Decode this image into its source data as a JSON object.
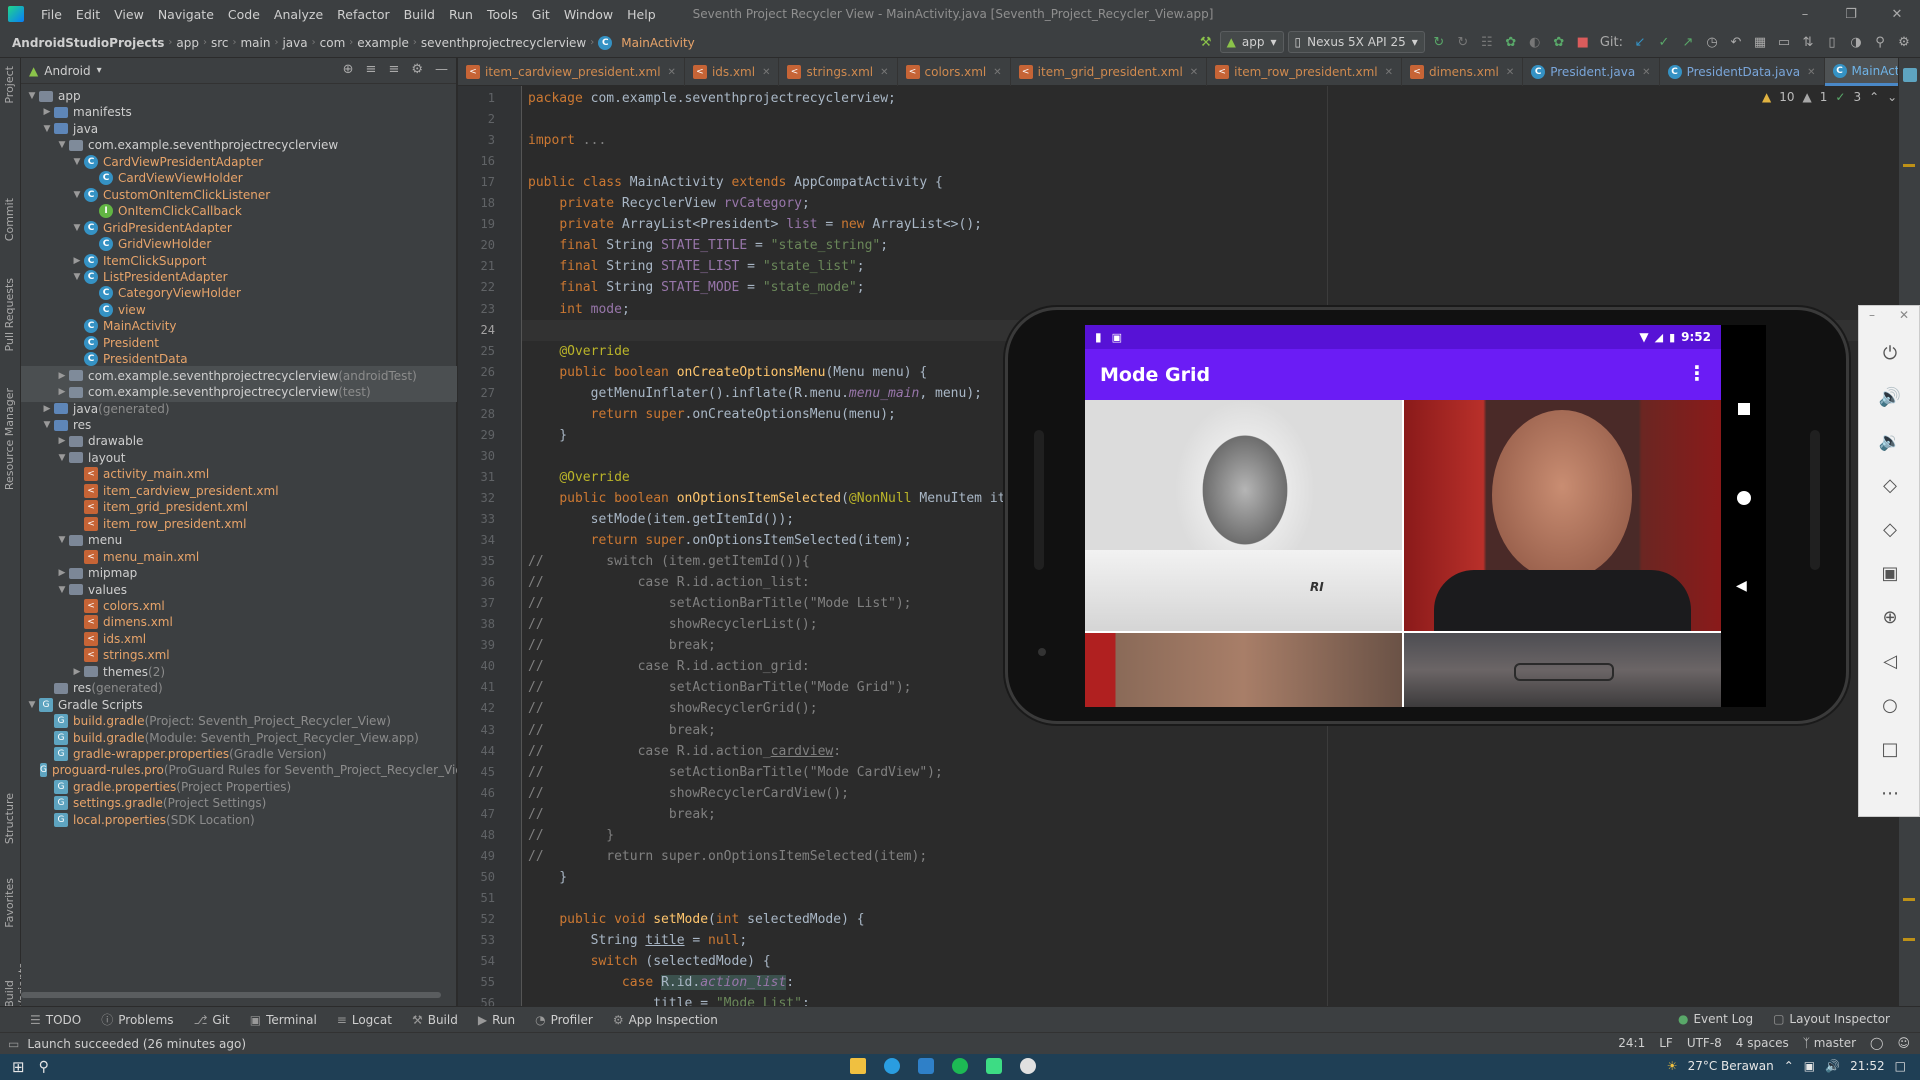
{
  "window": {
    "menus": [
      "File",
      "Edit",
      "View",
      "Navigate",
      "Code",
      "Analyze",
      "Refactor",
      "Build",
      "Run",
      "Tools",
      "Git",
      "Window",
      "Help"
    ],
    "title": "Seventh Project Recycler View - MainActivity.java [Seventh_Project_Recycler_View.app]"
  },
  "breadcrumb": [
    "AndroidStudioProjects",
    "app",
    "src",
    "main",
    "java",
    "com",
    "example",
    "seventhprojectrecyclerview",
    "MainActivity"
  ],
  "toolbar": {
    "run_config": "app",
    "device": "Nexus 5X API 25",
    "git_label": "Git:"
  },
  "left_strip": {
    "tabs": [
      "Project",
      "Commit",
      "Pull Requests",
      "Resource Manager",
      "Structure",
      "Favorites",
      "Build Variants"
    ]
  },
  "project_panel": {
    "view": "Android",
    "tree": [
      {
        "label": "app",
        "depth": 0,
        "icon": "folder",
        "color": "default",
        "arrow": "down"
      },
      {
        "label": "manifests",
        "depth": 1,
        "icon": "folder-blue",
        "color": "default",
        "arrow": "right"
      },
      {
        "label": "java",
        "depth": 1,
        "icon": "folder-blue",
        "color": "default",
        "arrow": "down"
      },
      {
        "label": "com.example.seventhprojectrecyclerview",
        "depth": 2,
        "icon": "pkg",
        "color": "default",
        "arrow": "down"
      },
      {
        "label": "CardViewPresidentAdapter",
        "depth": 3,
        "icon": "cls",
        "color": "orange",
        "arrow": "down"
      },
      {
        "label": "CardViewViewHolder",
        "depth": 4,
        "icon": "cls",
        "color": "orange",
        "arrow": ""
      },
      {
        "label": "CustomOnItemClickListener",
        "depth": 3,
        "icon": "cls",
        "color": "orange",
        "arrow": "down"
      },
      {
        "label": "OnItemClickCallback",
        "depth": 4,
        "icon": "iface",
        "color": "orange",
        "arrow": ""
      },
      {
        "label": "GridPresidentAdapter",
        "depth": 3,
        "icon": "cls",
        "color": "orange",
        "arrow": "down"
      },
      {
        "label": "GridViewHolder",
        "depth": 4,
        "icon": "cls",
        "color": "orange",
        "arrow": ""
      },
      {
        "label": "ItemClickSupport",
        "depth": 3,
        "icon": "cls",
        "color": "orange",
        "arrow": "right"
      },
      {
        "label": "ListPresidentAdapter",
        "depth": 3,
        "icon": "cls",
        "color": "orange",
        "arrow": "down"
      },
      {
        "label": "CategoryViewHolder",
        "depth": 4,
        "icon": "cls",
        "color": "orange",
        "arrow": ""
      },
      {
        "label": "view",
        "depth": 4,
        "icon": "cls",
        "color": "orange",
        "arrow": ""
      },
      {
        "label": "MainActivity",
        "depth": 3,
        "icon": "cls",
        "color": "orange",
        "arrow": ""
      },
      {
        "label": "President",
        "depth": 3,
        "icon": "cls",
        "color": "orange",
        "arrow": ""
      },
      {
        "label": "PresidentData",
        "depth": 3,
        "icon": "cls",
        "color": "orange",
        "arrow": ""
      },
      {
        "label": "com.example.seventhprojectrecyclerview",
        "suffix": " (androidTest)",
        "depth": 2,
        "icon": "pkg",
        "color": "default",
        "arrow": "right",
        "selected": true
      },
      {
        "label": "com.example.seventhprojectrecyclerview",
        "suffix": " (test)",
        "depth": 2,
        "icon": "pkg",
        "color": "default",
        "arrow": "right",
        "selected": true
      },
      {
        "label": "java",
        "suffix": " (generated)",
        "depth": 1,
        "icon": "folder-blue",
        "color": "default",
        "arrow": "right"
      },
      {
        "label": "res",
        "depth": 1,
        "icon": "folder-blue",
        "color": "default",
        "arrow": "down"
      },
      {
        "label": "drawable",
        "depth": 2,
        "icon": "folder",
        "color": "default",
        "arrow": "right"
      },
      {
        "label": "layout",
        "depth": 2,
        "icon": "folder",
        "color": "default",
        "arrow": "down"
      },
      {
        "label": "activity_main.xml",
        "depth": 3,
        "icon": "xml",
        "color": "orange",
        "arrow": ""
      },
      {
        "label": "item_cardview_president.xml",
        "depth": 3,
        "icon": "xml",
        "color": "orange",
        "arrow": ""
      },
      {
        "label": "item_grid_president.xml",
        "depth": 3,
        "icon": "xml",
        "color": "orange",
        "arrow": ""
      },
      {
        "label": "item_row_president.xml",
        "depth": 3,
        "icon": "xml",
        "color": "orange",
        "arrow": ""
      },
      {
        "label": "menu",
        "depth": 2,
        "icon": "folder",
        "color": "default",
        "arrow": "down"
      },
      {
        "label": "menu_main.xml",
        "depth": 3,
        "icon": "xml",
        "color": "orange",
        "arrow": ""
      },
      {
        "label": "mipmap",
        "depth": 2,
        "icon": "folder",
        "color": "default",
        "arrow": "right"
      },
      {
        "label": "values",
        "depth": 2,
        "icon": "folder",
        "color": "default",
        "arrow": "down"
      },
      {
        "label": "colors.xml",
        "depth": 3,
        "icon": "xml",
        "color": "orange",
        "arrow": ""
      },
      {
        "label": "dimens.xml",
        "depth": 3,
        "icon": "xml",
        "color": "orange",
        "arrow": ""
      },
      {
        "label": "ids.xml",
        "depth": 3,
        "icon": "xml",
        "color": "orange",
        "arrow": ""
      },
      {
        "label": "strings.xml",
        "depth": 3,
        "icon": "xml",
        "color": "orange",
        "arrow": ""
      },
      {
        "label": "themes",
        "suffix": " (2)",
        "depth": 3,
        "icon": "folder",
        "color": "default",
        "arrow": "right"
      },
      {
        "label": "res",
        "suffix": " (generated)",
        "depth": 1,
        "icon": "folder",
        "color": "default",
        "arrow": ""
      },
      {
        "label": "Gradle Scripts",
        "depth": 0,
        "icon": "gradle",
        "color": "default",
        "arrow": "down"
      },
      {
        "label": "build.gradle",
        "suffix": " (Project: Seventh_Project_Recycler_View)",
        "depth": 1,
        "icon": "gradle",
        "color": "orange",
        "arrow": ""
      },
      {
        "label": "build.gradle",
        "suffix": " (Module: Seventh_Project_Recycler_View.app)",
        "depth": 1,
        "icon": "gradle",
        "color": "orange",
        "arrow": ""
      },
      {
        "label": "gradle-wrapper.properties",
        "suffix": " (Gradle Version)",
        "depth": 1,
        "icon": "gradle",
        "color": "orange",
        "arrow": ""
      },
      {
        "label": "proguard-rules.pro",
        "suffix": " (ProGuard Rules for Seventh_Project_Recycler_View",
        "depth": 1,
        "icon": "gradle",
        "color": "orange",
        "arrow": ""
      },
      {
        "label": "gradle.properties",
        "suffix": " (Project Properties)",
        "depth": 1,
        "icon": "gradle",
        "color": "orange",
        "arrow": ""
      },
      {
        "label": "settings.gradle",
        "suffix": " (Project Settings)",
        "depth": 1,
        "icon": "gradle",
        "color": "orange",
        "arrow": ""
      },
      {
        "label": "local.properties",
        "suffix": " (SDK Location)",
        "depth": 1,
        "icon": "gradle",
        "color": "orange",
        "arrow": ""
      }
    ]
  },
  "editor_tabs": [
    {
      "label": "item_cardview_president.xml",
      "kind": "xml"
    },
    {
      "label": "ids.xml",
      "kind": "xml"
    },
    {
      "label": "strings.xml",
      "kind": "xml"
    },
    {
      "label": "colors.xml",
      "kind": "xml"
    },
    {
      "label": "item_grid_president.xml",
      "kind": "xml"
    },
    {
      "label": "item_row_president.xml",
      "kind": "xml"
    },
    {
      "label": "dimens.xml",
      "kind": "xml"
    },
    {
      "label": "President.java",
      "kind": "java"
    },
    {
      "label": "PresidentData.java",
      "kind": "java"
    },
    {
      "label": "MainActivity.java",
      "kind": "java",
      "active": true
    }
  ],
  "inspections": {
    "warnings": "10",
    "weak_warnings": "1",
    "ok": "3"
  },
  "code_lines": [
    {
      "n": "1",
      "html": "<span class=\"kw\">package</span> com.example.seventhprojectrecyclerview;"
    },
    {
      "n": "2",
      "html": ""
    },
    {
      "n": "3",
      "html": "<span class=\"kw\">import</span> <span class=\"cmt\">...</span>"
    },
    {
      "n": "16",
      "html": ""
    },
    {
      "n": "17",
      "html": "<span class=\"kw\">public class</span> MainActivity <span class=\"kw\">extends</span> AppCompatActivity {"
    },
    {
      "n": "18",
      "html": "    <span class=\"kw\">private</span> RecyclerView <span class=\"field\">rvCategory</span>;"
    },
    {
      "n": "19",
      "html": "    <span class=\"kw\">private</span> ArrayList&lt;President&gt; <span class=\"field\">list</span> = <span class=\"kw\">new</span> ArrayList&lt;&gt;();"
    },
    {
      "n": "20",
      "html": "    <span class=\"kw\">final</span> String <span class=\"field\">STATE_TITLE</span> = <span class=\"str\">\"state_string\"</span>;"
    },
    {
      "n": "21",
      "html": "    <span class=\"kw\">final</span> String <span class=\"field\">STATE_LIST</span> = <span class=\"str\">\"state_list\"</span>;"
    },
    {
      "n": "22",
      "html": "    <span class=\"kw\">final</span> String <span class=\"field\">STATE_MODE</span> = <span class=\"str\">\"state_mode\"</span>;"
    },
    {
      "n": "23",
      "html": "    <span class=\"kw\">int</span> <span class=\"field\">mode</span>;"
    },
    {
      "n": "24",
      "html": "",
      "current": true
    },
    {
      "n": "25",
      "html": "    <span class=\"ann\">@Override</span>"
    },
    {
      "n": "26",
      "html": "    <span class=\"kw\">public boolean</span> <span class=\"fn\">onCreateOptionsMenu</span>(Menu menu) {"
    },
    {
      "n": "27",
      "html": "        getMenuInflater().inflate(R.menu.<span class=\"fld-i\">menu_main</span>, menu);"
    },
    {
      "n": "28",
      "html": "        <span class=\"kw\">return super</span>.onCreateOptionsMenu(menu);"
    },
    {
      "n": "29",
      "html": "    }"
    },
    {
      "n": "30",
      "html": ""
    },
    {
      "n": "31",
      "html": "    <span class=\"ann\">@Override</span>"
    },
    {
      "n": "32",
      "html": "    <span class=\"kw\">public boolean</span> <span class=\"fn\">onOptionsItemSelected</span>(<span class=\"ann\">@NonNull</span> MenuItem item) {"
    },
    {
      "n": "33",
      "html": "        setMode(item.getItemId());"
    },
    {
      "n": "34",
      "html": "        <span class=\"kw\">return super</span>.onOptionsItemSelected(item);"
    },
    {
      "n": "35",
      "html": "<span class=\"cmt\">//</span>        <span class=\"cmt\">switch (item.getItemId()){</span>"
    },
    {
      "n": "36",
      "html": "<span class=\"cmt\">//            case R.id.action_list:</span>"
    },
    {
      "n": "37",
      "html": "<span class=\"cmt\">//                setActionBarTitle(\"Mode List\");</span>"
    },
    {
      "n": "38",
      "html": "<span class=\"cmt\">//                showRecyclerList();</span>"
    },
    {
      "n": "39",
      "html": "<span class=\"cmt\">//                break;</span>"
    },
    {
      "n": "40",
      "html": "<span class=\"cmt\">//            case R.id.action_grid:</span>"
    },
    {
      "n": "41",
      "html": "<span class=\"cmt\">//                setActionBarTitle(\"Mode Grid\");</span>"
    },
    {
      "n": "42",
      "html": "<span class=\"cmt\">//                showRecyclerGrid();</span>"
    },
    {
      "n": "43",
      "html": "<span class=\"cmt\">//                break;</span>"
    },
    {
      "n": "44",
      "html": "<span class=\"cmt\">//            case R.id.action_<span class=\"ul\">cardview</span>:</span>"
    },
    {
      "n": "45",
      "html": "<span class=\"cmt\">//                setActionBarTitle(\"Mode CardView\");</span>"
    },
    {
      "n": "46",
      "html": "<span class=\"cmt\">//                showRecyclerCardView();</span>"
    },
    {
      "n": "47",
      "html": "<span class=\"cmt\">//                break;</span>"
    },
    {
      "n": "48",
      "html": "<span class=\"cmt\">//        }</span>"
    },
    {
      "n": "49",
      "html": "<span class=\"cmt\">//        return super.onOptionsItemSelected(item);</span>"
    },
    {
      "n": "50",
      "html": "    }"
    },
    {
      "n": "51",
      "html": ""
    },
    {
      "n": "52",
      "html": "    <span class=\"kw\">public void</span> <span class=\"fn\">setMode</span>(<span class=\"kw\">int</span> selectedMode) {"
    },
    {
      "n": "53",
      "html": "        String <span class=\"ul\">title</span> = <span class=\"kw\">null</span>;"
    },
    {
      "n": "54",
      "html": "        <span class=\"kw\">switch</span> (selectedMode) {"
    },
    {
      "n": "55",
      "html": "            <span class=\"kw\">case</span> <span class=\"hl-word\">R.id.<span class=\"fld-i\">action_list</span></span>:"
    },
    {
      "n": "56",
      "html": "                <span class=\"ul\">title</span> = <span class=\"str\">\"Mode List\"</span>;"
    }
  ],
  "emulator": {
    "clock": "9:52",
    "app_title": "Mode Grid",
    "overflow_icon": "more-vert-icon",
    "photo_badges": [
      "RI",
      "RI"
    ]
  },
  "bottom_tabs": [
    "TODO",
    "Problems",
    "Git",
    "Terminal",
    "Logcat",
    "Build",
    "Run",
    "Profiler",
    "App Inspection"
  ],
  "bottom_tabs_right": [
    "Event Log",
    "Layout Inspector"
  ],
  "status": {
    "message": "Launch succeeded (26 minutes ago)",
    "position": "24:1",
    "line_sep": "LF",
    "encoding": "UTF-8",
    "indent": "4 spaces",
    "branch": "master"
  },
  "taskbar": {
    "weather": "27°C  Berawan",
    "time": "21:52"
  },
  "colors": {
    "app_bar": "#6b1cf5",
    "status_bar": "#5712d6",
    "ide_bg": "#2b2b2b",
    "panel_bg": "#3c3f41"
  }
}
